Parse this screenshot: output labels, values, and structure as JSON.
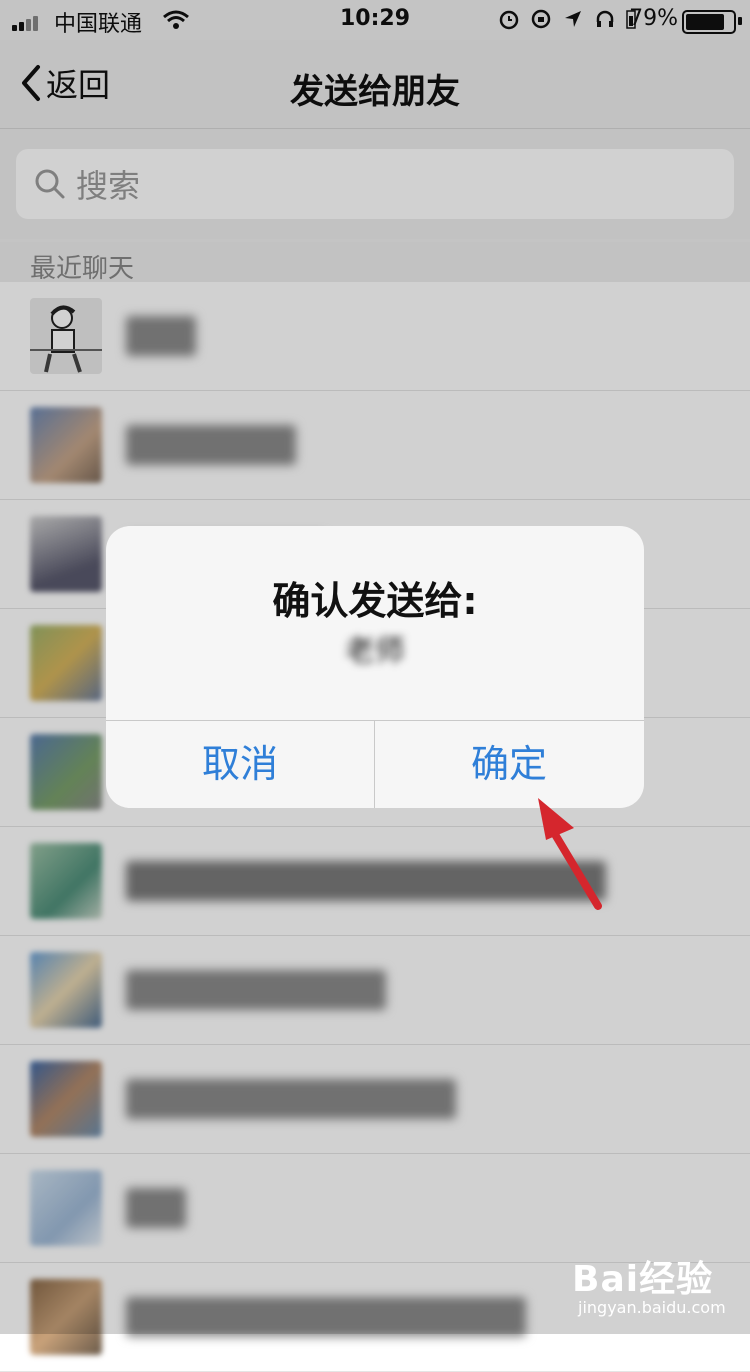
{
  "status_bar": {
    "carrier": "中国联通",
    "time": "10:29",
    "battery": "79%"
  },
  "navbar": {
    "back_label": "返回",
    "title": "发送给朋友"
  },
  "search": {
    "placeholder": "搜索"
  },
  "section": {
    "title": "最近聊天"
  },
  "dialog": {
    "title": "确认发送给:",
    "recipient": "老师",
    "cancel_label": "取消",
    "confirm_label": "确定"
  },
  "watermark": {
    "brand": "Bai经验",
    "url": "jingyan.baidu.com"
  },
  "colors": {
    "accent": "#2f7fd8",
    "arrow": "#d5262d"
  }
}
